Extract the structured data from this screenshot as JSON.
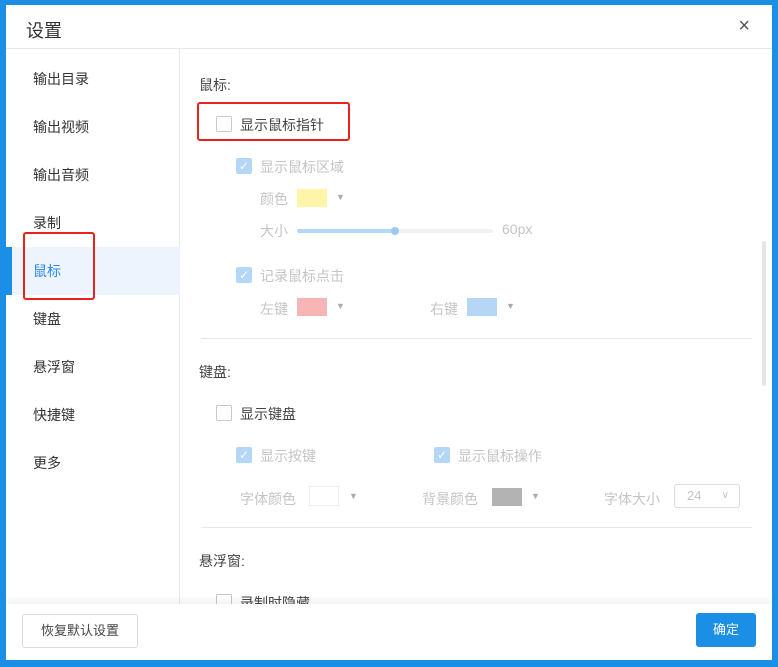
{
  "title": "设置",
  "close_icon": "×",
  "sidebar": {
    "items": [
      {
        "label": "输出目录"
      },
      {
        "label": "输出视频"
      },
      {
        "label": "输出音频"
      },
      {
        "label": "录制"
      },
      {
        "label": "鼠标"
      },
      {
        "label": "键盘"
      },
      {
        "label": "悬浮窗"
      },
      {
        "label": "快捷键"
      },
      {
        "label": "更多"
      }
    ],
    "active": "鼠标"
  },
  "mouse": {
    "heading": "鼠标:",
    "show_pointer": "显示鼠标指针",
    "show_area": "显示鼠标区域",
    "color_label": "颜色",
    "color": "#fff5a8",
    "size_label": "大小",
    "size_value": "60px",
    "size_fraction": 0.5,
    "record_click": "记录鼠标点击",
    "left_label": "左键",
    "left_color": "#f8b5b5",
    "right_label": "右键",
    "right_color": "#b5d7f5"
  },
  "keyboard": {
    "heading": "键盘:",
    "show_keyboard": "显示键盘",
    "show_keys": "显示按键",
    "show_mouse_ops": "显示鼠标操作",
    "font_color_label": "字体颜色",
    "font_color": "#ffffff",
    "bg_color_label": "背景颜色",
    "bg_color": "#b3b3b3",
    "font_size_label": "字体大小",
    "font_size": "24"
  },
  "floating": {
    "heading": "悬浮窗:",
    "hide_when_recording": "录制时隐藏"
  },
  "footer": {
    "reset": "恢复默认设置",
    "ok": "确定"
  },
  "colors": {
    "accent": "#1b8fe6",
    "highlight": "#e8231c"
  }
}
